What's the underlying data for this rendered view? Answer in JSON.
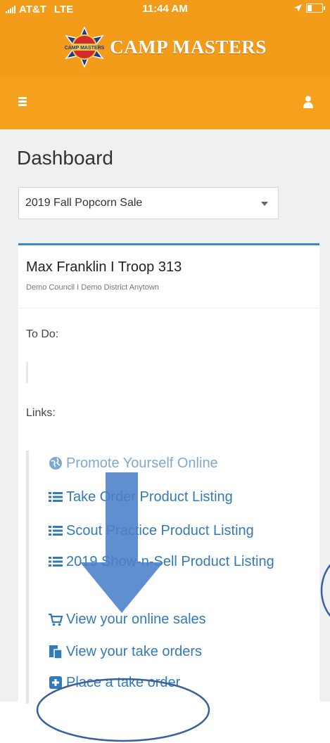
{
  "status_bar": {
    "carrier": "AT&T",
    "network": "LTE",
    "time": "11:44 AM"
  },
  "brand": {
    "logo_text": "CAMP MASTERS",
    "logo_emblem_text": "CAMP MASTERS",
    "color": "#f39c1a"
  },
  "navbar": {
    "menu_icon": "hamburger-icon",
    "user_icon": "user-icon",
    "color": "#f5a11d"
  },
  "dashboard": {
    "title": "Dashboard",
    "sale_select": {
      "selected": "2019 Fall Popcorn Sale"
    },
    "card": {
      "title": "Max Franklin I Troop 313",
      "subtitle": "Demo Council I Demo District Anytown",
      "todo_label": "To Do:",
      "links_label": "Links:",
      "links": [
        {
          "icon": "globe-icon",
          "label": "Promote Yourself Online"
        },
        {
          "icon": "list-icon",
          "label": "Take Order Product Listing"
        },
        {
          "icon": "list-icon",
          "label": "Scout Practice Product Listing"
        },
        {
          "icon": "list-icon",
          "label": "2019 Show-n-Sell Product Listing"
        },
        {
          "icon": "cart-icon",
          "label": "View your online sales"
        },
        {
          "icon": "orders-icon",
          "label": "View your take orders"
        },
        {
          "icon": "plus-square-icon",
          "label": "Place a take order"
        }
      ]
    }
  },
  "annotation": {
    "arrow_color": "#4a80c8",
    "circle_color": "#3a5f9a"
  }
}
